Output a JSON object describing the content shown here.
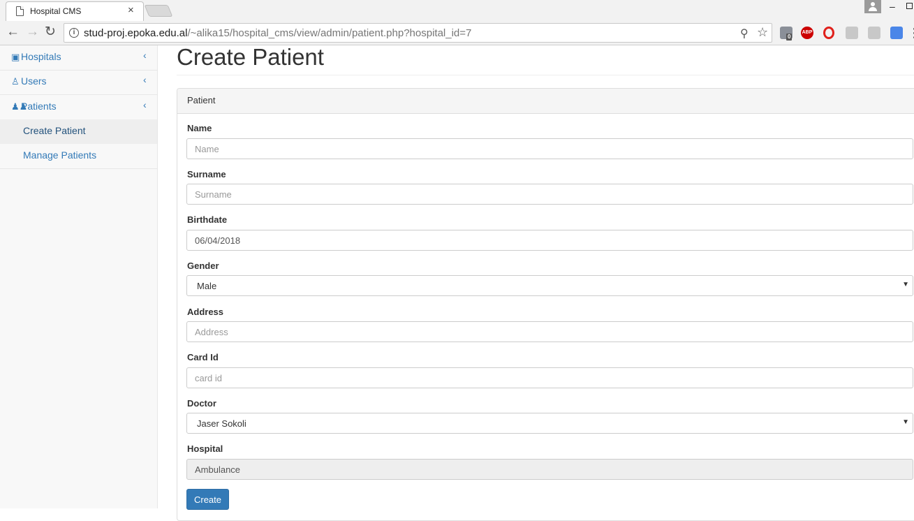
{
  "browser": {
    "tab_title": "Hospital CMS",
    "tab_close": "×",
    "url_host": "stud-proj.epoka.edu.al",
    "url_path": "/~alika15/hospital_cms/view/admin/patient.php?hospital_id=7",
    "ext_badge": "0",
    "ext_abp": "ABP"
  },
  "sidebar": {
    "items": [
      {
        "label": "Hospitals",
        "icon": "hospital-icon"
      },
      {
        "label": "Users",
        "icon": "user-icon"
      },
      {
        "label": "Patients",
        "icon": "users-group-icon"
      }
    ],
    "subitems": [
      {
        "label": "Create Patient",
        "active": true
      },
      {
        "label": "Manage Patients",
        "active": false
      }
    ]
  },
  "main": {
    "title": "Create Patient",
    "panel_heading": "Patient",
    "fields": {
      "name": {
        "label": "Name",
        "placeholder": "Name",
        "value": ""
      },
      "surname": {
        "label": "Surname",
        "placeholder": "Surname",
        "value": ""
      },
      "birthdate": {
        "label": "Birthdate",
        "value": "06/04/2018"
      },
      "gender": {
        "label": "Gender",
        "value": "Male"
      },
      "address": {
        "label": "Address",
        "placeholder": "Address",
        "value": ""
      },
      "card_id": {
        "label": "Card Id",
        "placeholder": "card id",
        "value": ""
      },
      "doctor": {
        "label": "Doctor",
        "value": "Jaser Sokoli"
      },
      "hospital": {
        "label": "Hospital",
        "value": "Ambulance"
      }
    },
    "create_label": "Create"
  },
  "colors": {
    "primary": "#337ab7",
    "sidebar_bg": "#f8f8f8",
    "active_item_bg": "#eeeeee"
  }
}
